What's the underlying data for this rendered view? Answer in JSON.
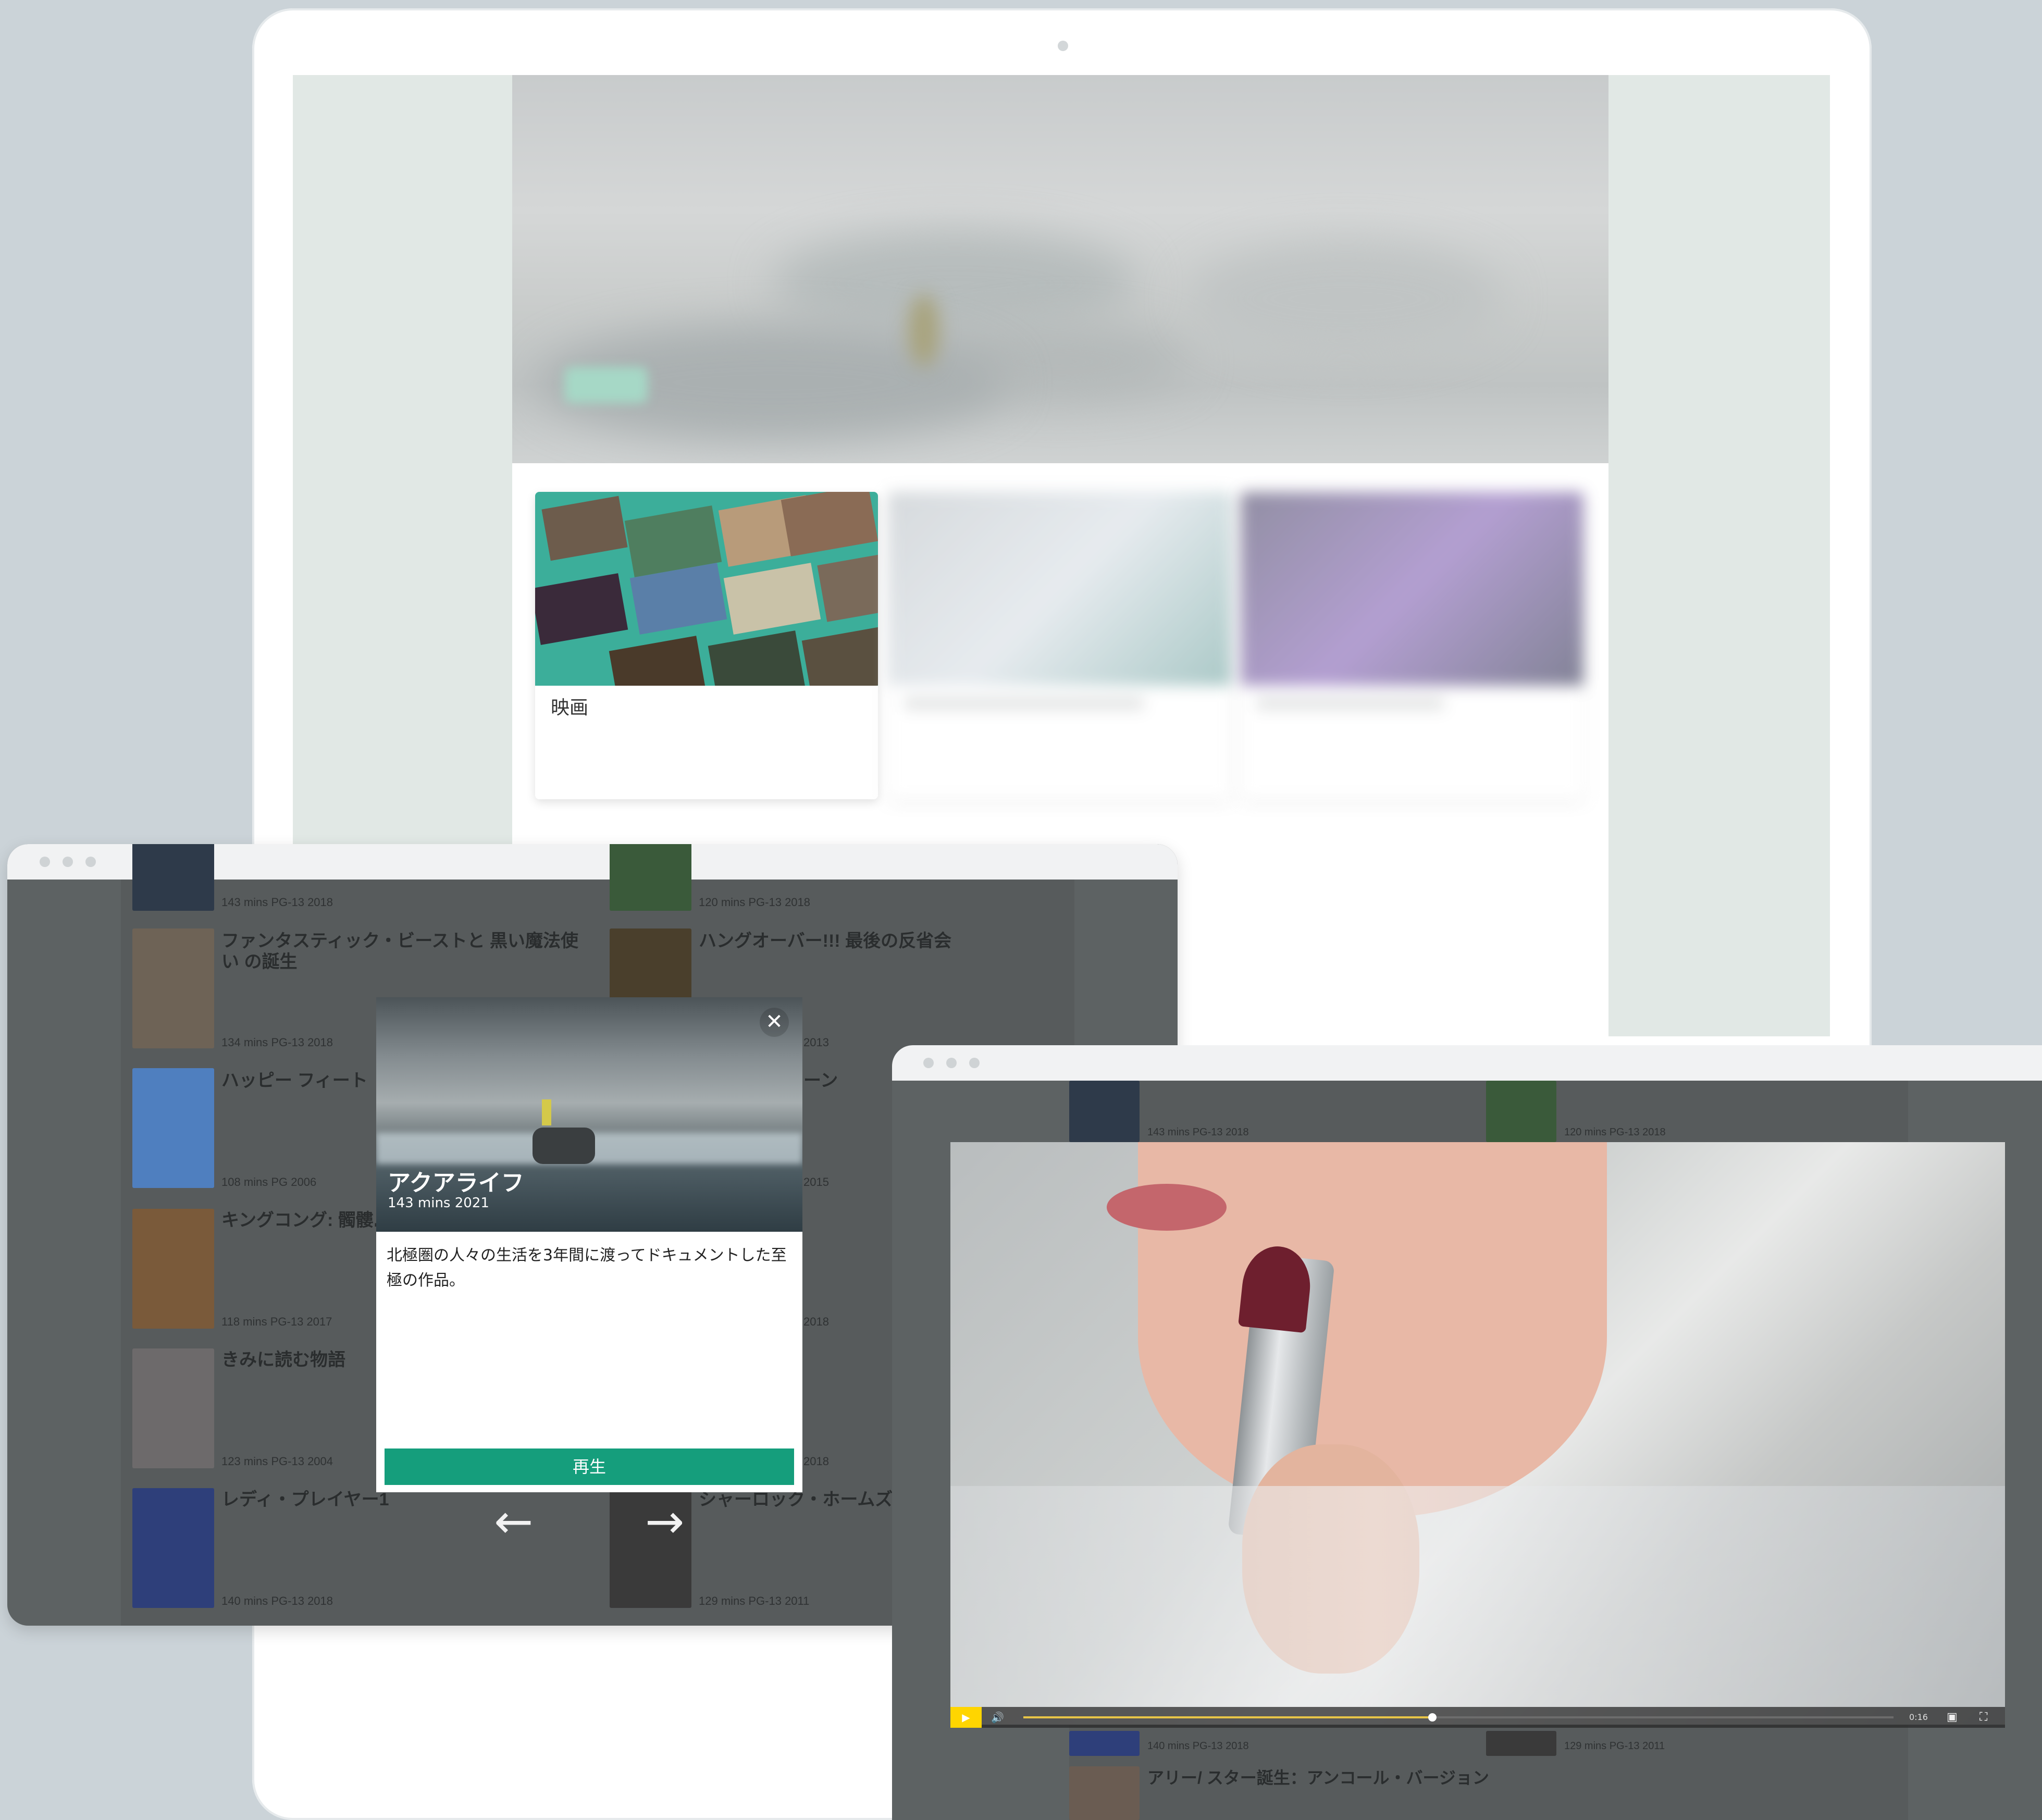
{
  "laptop": {
    "cards": [
      {
        "label": "映画"
      }
    ]
  },
  "window1": {
    "list": [
      {
        "title": "",
        "meta": "143 mins  PG-13  2018",
        "poster": "#2e3a4a"
      },
      {
        "title": "",
        "meta": "120 mins  PG-13  2018",
        "poster": "#3a5a3a"
      },
      {
        "title": "ファンタスティック・ビーストと 黒い魔法使い の誕生",
        "meta": "134 mins  PG-13  2018",
        "poster": "#6e6356"
      },
      {
        "title": "ハングオーバー!!! 最後の反省会",
        "meta": "",
        "poster": "#4a3f2c"
      },
      {
        "title": "ハッピー フィート",
        "meta": "108 mins  PG  2006",
        "poster": "#4f7fbf"
      },
      {
        "title": "",
        "meta": "2013",
        "poster": ""
      },
      {
        "title": "キングコング: 髑髏島の",
        "meta": "118 mins  PG-13  2017",
        "poster": "#7a5a3a"
      },
      {
        "title": "",
        "meta": "2015",
        "poster": ""
      },
      {
        "title": "きみに読む物語",
        "meta": "123 mins  PG-13  2004",
        "poster": "#6d6a6b"
      },
      {
        "title": "",
        "meta": "2018",
        "poster": ""
      },
      {
        "title": "レディ・プレイヤー1",
        "meta": "140 mins  PG-13  2018",
        "poster": "#2e3f7a"
      },
      {
        "title": "シャーロック・ホームズ シ",
        "meta": "129 mins  PG-13  2011",
        "poster": "#3a3a3a"
      }
    ],
    "extra_meta": [
      "2018",
      "ーン"
    ],
    "modal": {
      "title": "アクアライフ",
      "meta": "143 mins  2021",
      "description": "北極圏の人々の生活を3年間に渡ってドキュメントした至極の作品。",
      "play_label": "再生",
      "close_glyph": "✕",
      "prev_glyph": "←",
      "next_glyph": "→"
    }
  },
  "window2": {
    "list": [
      {
        "meta": "143 mins  PG-13  2018"
      },
      {
        "meta": "120 mins  PG-13  2018"
      },
      {
        "meta": "140 mins  PG-13  2018"
      },
      {
        "meta": "129 mins  PG-13  2011"
      },
      {
        "title": "アリー/ スター誕生：アンコール・バージョン"
      }
    ],
    "player": {
      "time": "0:16",
      "progress": 0.47,
      "play_glyph": "▶",
      "volume_glyph": "🔊",
      "pip_glyph": "▣",
      "fullscreen_glyph": "⛶"
    }
  },
  "colors": {
    "accent": "#159e7c",
    "play_button": "#ffd500",
    "progress": "#e8c547"
  }
}
